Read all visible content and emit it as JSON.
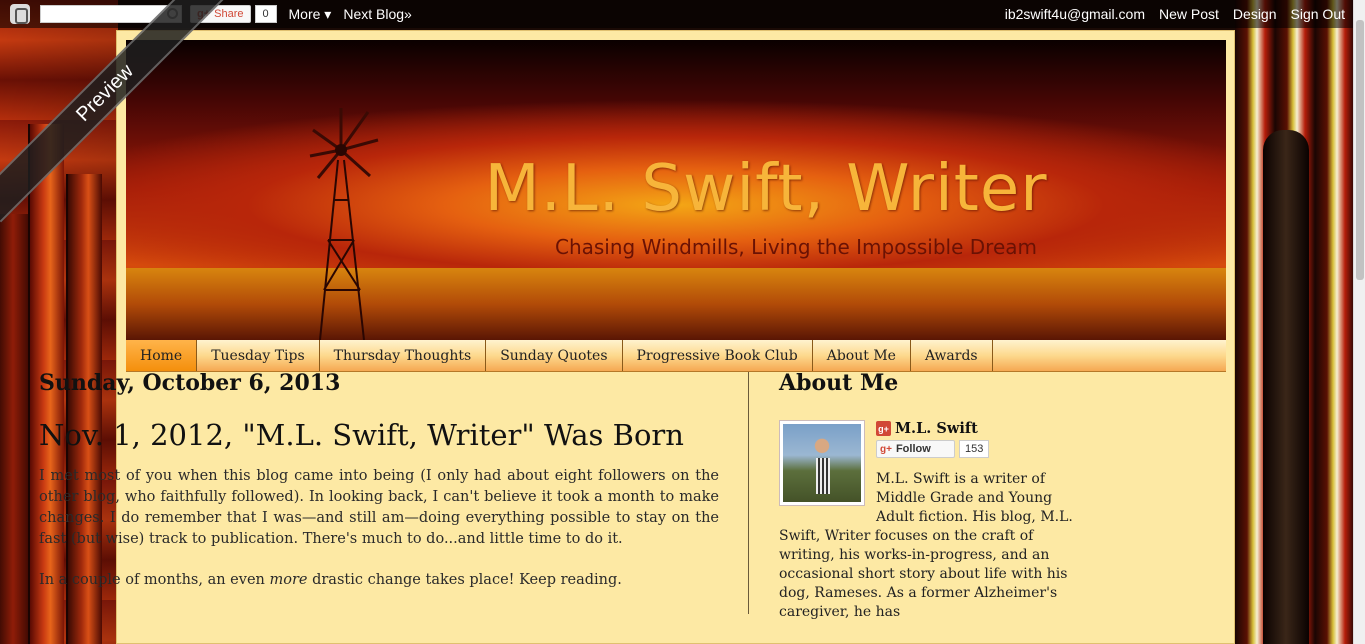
{
  "navbar": {
    "search_placeholder": "",
    "share_label": "Share",
    "share_count": "0",
    "more_label": "More ▾",
    "next_blog_label": "Next Blog»",
    "email": "ib2swift4u@gmail.com",
    "new_post_label": "New Post",
    "design_label": "Design",
    "sign_out_label": "Sign Out"
  },
  "ribbon": {
    "label": "Preview"
  },
  "header": {
    "title": "M.L. Swift, Writer",
    "tagline": "Chasing Windmills, Living the Impossible Dream"
  },
  "tabs": [
    {
      "label": "Home",
      "active": true
    },
    {
      "label": "Tuesday Tips"
    },
    {
      "label": "Thursday Thoughts"
    },
    {
      "label": "Sunday Quotes"
    },
    {
      "label": "Progressive Book Club"
    },
    {
      "label": "About Me"
    },
    {
      "label": "Awards"
    }
  ],
  "post": {
    "date": "Sunday, October 6, 2013",
    "title": "Nov. 1, 2012, \"M.L. Swift, Writer\" Was Born",
    "para1": "I met most of you when this blog came into being (I only had about eight followers on the other blog, who faithfully followed). In looking back, I can't believe it took a month to make changes. I do remember that I was—and still am—doing everything possible to stay on the fast (but wise) track to publication. There's much to do...and little time to do it.",
    "para2_before": "In a couple of months, an even ",
    "para2_em": "more",
    "para2_after": " drastic change takes place! Keep reading."
  },
  "sidebar": {
    "heading": "About Me",
    "name": "M.L. Swift",
    "follow_label": "Follow",
    "follow_count": "153",
    "desc_indented": "M.L. Swift is a writer of Middle Grade and Young Adult fiction. His blog, M.L.",
    "desc_rest": "Swift, Writer focuses on the craft of writing, his works-in-progress, and an occasional short story about life with his dog, Rameses. As a former Alzheimer's caregiver, he has"
  },
  "colors": {
    "page_bg": "#fde9a4",
    "tab_active": "#f48f0c",
    "title_color": "#f7b53a"
  }
}
